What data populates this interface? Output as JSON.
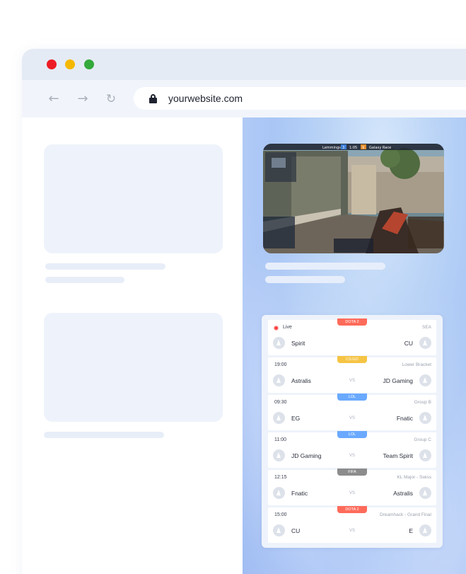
{
  "browser": {
    "nav": {
      "back_icon": "arrow-left-icon",
      "forward_icon": "arrow-right-icon",
      "reload_icon": "reload-icon"
    },
    "url": "yourwebsite.com",
    "colors": {
      "red": "#ed1c24",
      "yellow": "#f5b800",
      "green": "#34a93c"
    }
  },
  "stream": {
    "hud_team_left": "Lemmings",
    "hud_team_right": "Galaxy Race",
    "hud_score_left": "3",
    "hud_score_right": "9",
    "hud_time": "1:05"
  },
  "matches": [
    {
      "game": "DOTA 2",
      "game_color": "#ff6b5a",
      "time": "",
      "live": true,
      "live_label": "Live",
      "stage": "SEA",
      "team1": "Spirit",
      "team2": "CU",
      "vs": ""
    },
    {
      "game": "CS:GO",
      "game_color": "#f6c445",
      "time": "19:00",
      "live": false,
      "stage": "Lower Bracket",
      "team1": "Astralis",
      "team2": "JD Gaming",
      "vs": "VS"
    },
    {
      "game": "LOL",
      "game_color": "#6aa9ff",
      "time": "09:30",
      "live": false,
      "stage": "Group B",
      "team1": "EG",
      "team2": "Fnatic",
      "vs": "VS"
    },
    {
      "game": "LOL",
      "game_color": "#6aa9ff",
      "time": "11:00",
      "live": false,
      "stage": "Group C",
      "team1": "JD Gaming",
      "team2": "Team Spirit",
      "vs": "VS"
    },
    {
      "game": "FIFA",
      "game_color": "#8c8c8c",
      "time": "12:15",
      "live": false,
      "stage": "KL Major - Swiss",
      "team1": "Fnatic",
      "team2": "Astralis",
      "vs": "VS"
    },
    {
      "game": "DOTA 2",
      "game_color": "#ff6b5a",
      "time": "15:00",
      "live": false,
      "stage": "Dreamhack - Grand Final",
      "team1": "CU",
      "team2": "E",
      "vs": "VS"
    }
  ]
}
